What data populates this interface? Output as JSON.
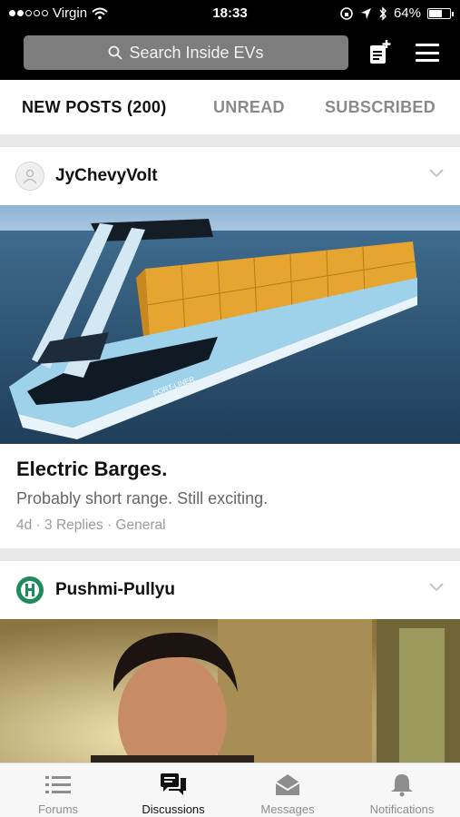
{
  "status_bar": {
    "carrier": "Virgin",
    "time": "18:33",
    "battery": "64%",
    "battery_level": 0.64,
    "signal_bars": 2
  },
  "header": {
    "search_placeholder": "Search Inside EVs"
  },
  "tabs": [
    {
      "label": "NEW POSTS (200)",
      "active": true
    },
    {
      "label": "UNREAD",
      "active": false
    },
    {
      "label": "SUBSCRIBED",
      "active": false
    }
  ],
  "posts": [
    {
      "author": "JyChevyVolt",
      "title": "Electric Barges.",
      "excerpt": "Probably short range. Still exciting.",
      "meta": "4d · 3 Replies · General",
      "image_text": "PORT-LINER"
    },
    {
      "author": "Pushmi-Pullyu"
    }
  ],
  "bottom_nav": [
    {
      "label": "Forums",
      "icon": "list-icon",
      "active": false
    },
    {
      "label": "Discussions",
      "icon": "chat-bubbles-icon",
      "active": true
    },
    {
      "label": "Messages",
      "icon": "envelope-icon",
      "active": false
    },
    {
      "label": "Notifications",
      "icon": "bell-icon",
      "active": false
    }
  ]
}
